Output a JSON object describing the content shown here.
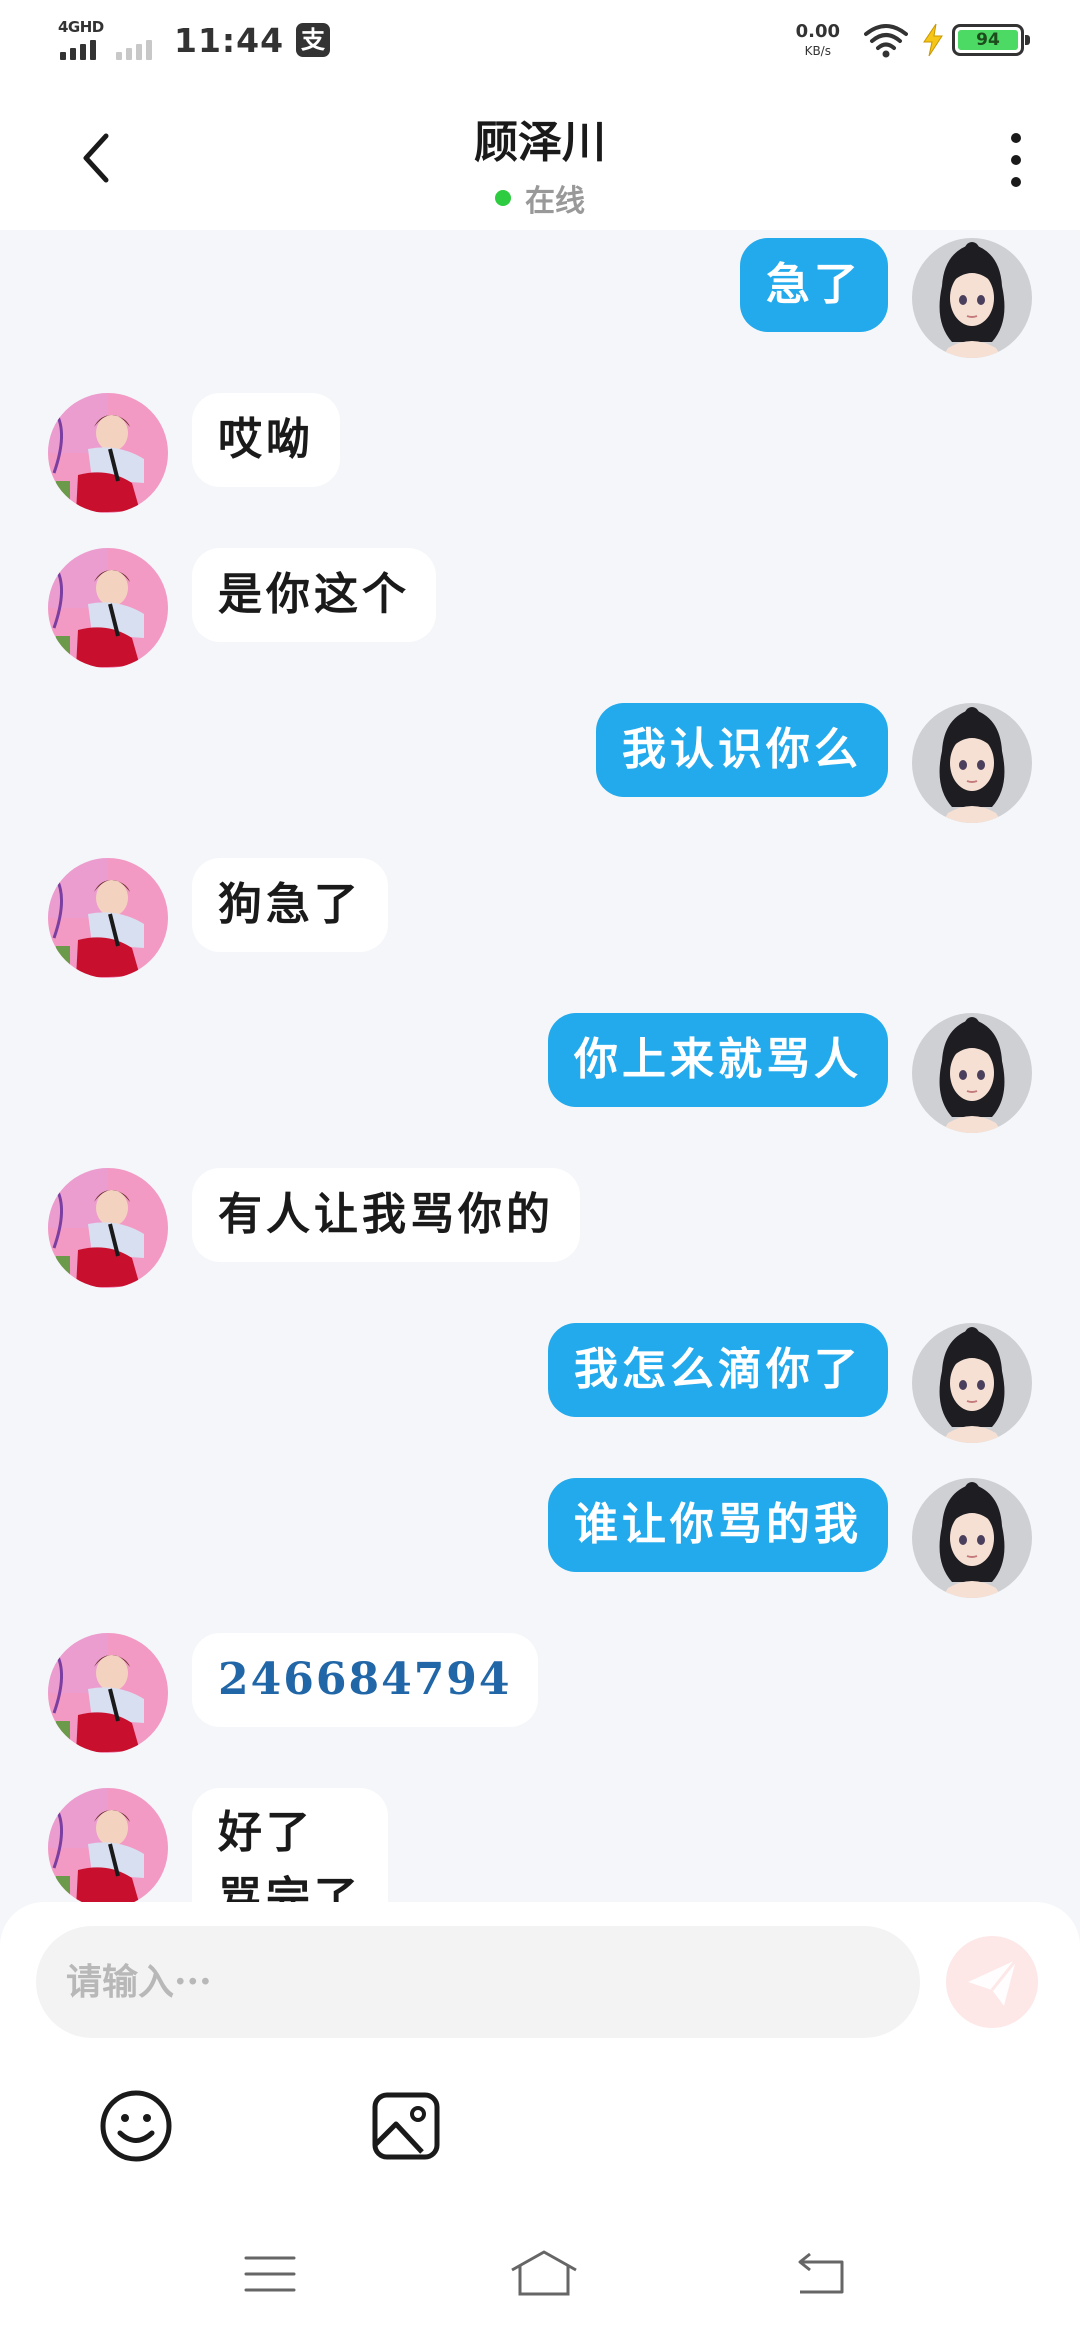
{
  "status_bar": {
    "network": "4GHD",
    "time": "11:44",
    "pay_icon": "支",
    "speed_value": "0.00",
    "speed_unit": "KB/s",
    "battery": "94",
    "icons": [
      "signal-icon",
      "wifi-icon",
      "charging-icon",
      "battery-icon",
      "pay-icon"
    ]
  },
  "header": {
    "title": "顾泽川",
    "status": "在线",
    "status_color": "#2ecc40",
    "icons": [
      "back-arrow-icon",
      "more-vert-icon"
    ]
  },
  "messages": [
    {
      "from": "me",
      "text": "急了"
    },
    {
      "from": "them",
      "text": "哎呦"
    },
    {
      "from": "them",
      "text": "是你这个"
    },
    {
      "from": "me",
      "text": "我认识你么"
    },
    {
      "from": "them",
      "text": "狗急了"
    },
    {
      "from": "me",
      "text": "你上来就骂人"
    },
    {
      "from": "them",
      "text": "有人让我骂你的"
    },
    {
      "from": "me",
      "text": "我怎么滴你了"
    },
    {
      "from": "me",
      "text": "谁让你骂的我"
    },
    {
      "from": "them",
      "text": "246684794"
    },
    {
      "from": "them",
      "text": "好了\n骂完了"
    }
  ],
  "input": {
    "placeholder": "请输入···",
    "value": ""
  },
  "toolbar": {
    "icons": [
      "send-icon",
      "emoji-icon",
      "image-icon"
    ]
  },
  "navbar": {
    "icons": [
      "menu-icon",
      "home-icon",
      "back-icon"
    ]
  },
  "colors": {
    "my_bubble": "#22aaec",
    "their_bubble": "#ffffff",
    "number_link": "#2166a7",
    "background": "#f4f6f9"
  }
}
